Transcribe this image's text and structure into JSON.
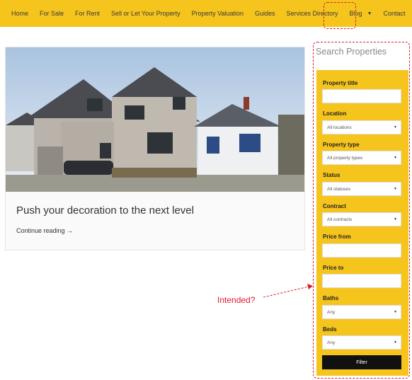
{
  "nav": {
    "items": [
      {
        "label": "Home"
      },
      {
        "label": "For Sale"
      },
      {
        "label": "For Rent"
      },
      {
        "label": "Sell or Let Your Property"
      },
      {
        "label": "Property Valuation"
      },
      {
        "label": "Guides"
      },
      {
        "label": "Services Directory"
      },
      {
        "label": "Blog"
      },
      {
        "label": "Contact"
      }
    ],
    "blog_caret_icon": "chevron-down-icon"
  },
  "post": {
    "title": "Push your decoration to the next level",
    "continue_label": "Continue reading →"
  },
  "sidebar": {
    "title": "Search Properties",
    "fields": {
      "property_title": {
        "label": "Property title",
        "value": ""
      },
      "location": {
        "label": "Location",
        "value": "All locations"
      },
      "property_type": {
        "label": "Property type",
        "value": "All property types"
      },
      "status": {
        "label": "Status",
        "value": "All statuses"
      },
      "contract": {
        "label": "Contract",
        "value": "All contracts"
      },
      "price_from": {
        "label": "Price from",
        "value": ""
      },
      "price_to": {
        "label": "Price to",
        "value": ""
      },
      "baths": {
        "label": "Baths",
        "value": "Any"
      },
      "beds": {
        "label": "Beds",
        "value": "Any"
      }
    },
    "filter_label": "Filter"
  },
  "annotation": {
    "text": "Intended?",
    "color": "#e0192a"
  },
  "colors": {
    "accent": "#f5c41d",
    "button": "#111111"
  }
}
